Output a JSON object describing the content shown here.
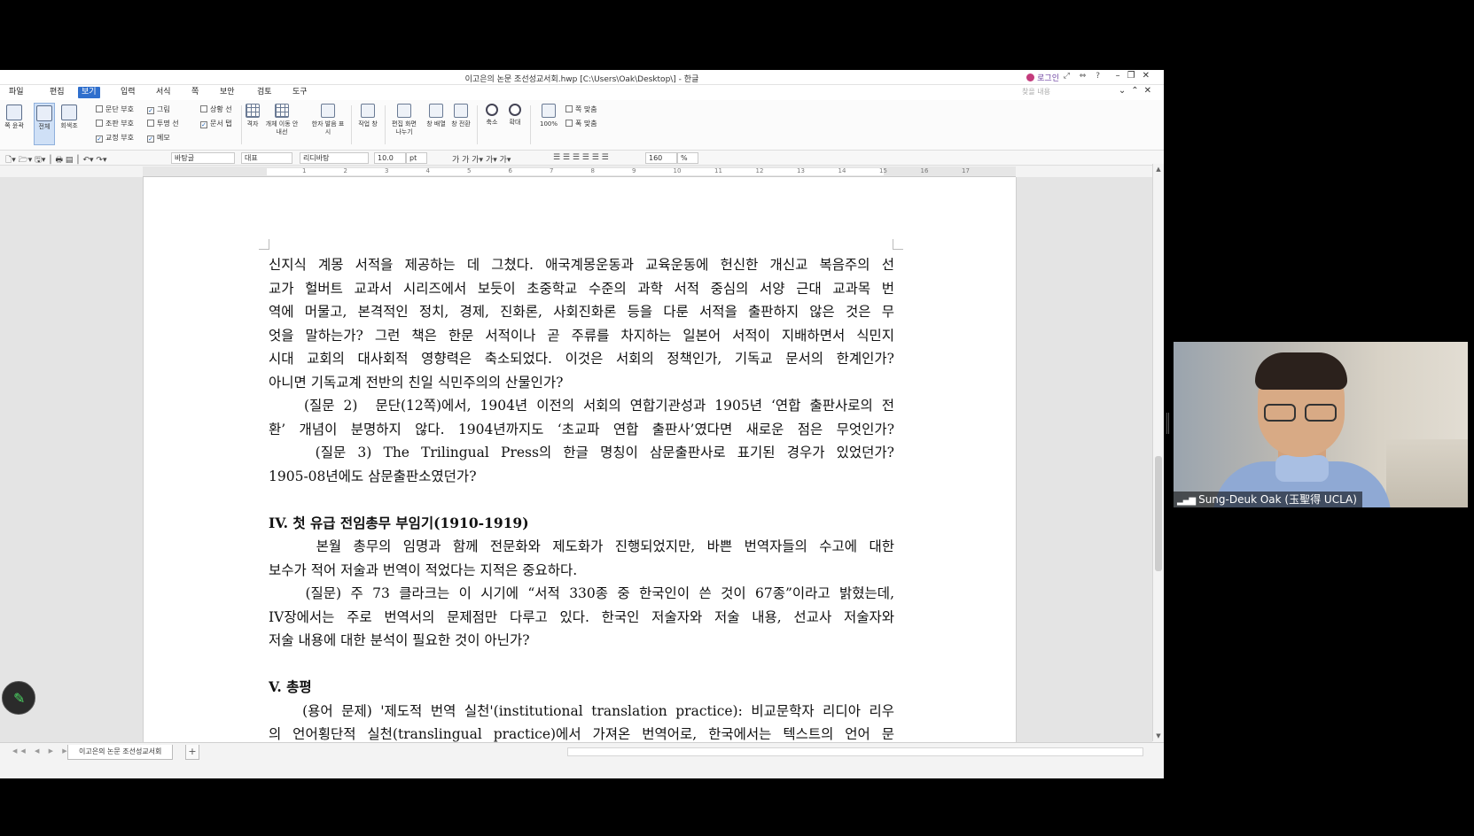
{
  "window": {
    "title": "이고은의 논문 조선성교서회.hwp [C:\\Users\\Oak\\Desktop\\] - 한글",
    "login_label": "로그인"
  },
  "menu": {
    "items": [
      "파일",
      "편집",
      "보기",
      "입력",
      "서식",
      "쪽",
      "보안",
      "검토",
      "도구"
    ],
    "active": "보기",
    "search_placeholder": "찾을 내용"
  },
  "ribbon": {
    "big_buttons": [
      "쪽 윤곽",
      "전체",
      "회색조"
    ],
    "checkboxes_col1": [
      {
        "label": "문단 부호",
        "checked": false
      },
      {
        "label": "조판 부호",
        "checked": false
      },
      {
        "label": "교정 부호",
        "checked": true
      }
    ],
    "checkboxes_col2": [
      {
        "label": "그림",
        "checked": true
      },
      {
        "label": "투명 선",
        "checked": false
      },
      {
        "label": "메모",
        "checked": true
      }
    ],
    "checkboxes_col3": [
      {
        "label": "상황 선",
        "checked": false
      },
      {
        "label": "문서 탭",
        "checked": true
      }
    ],
    "tools": [
      "격자",
      "개체 이동 안내선",
      "한자 발음 표시",
      "작업 창",
      "편집 화면 나누기",
      "창 배열",
      "창 전환",
      "축소",
      "확대",
      "100%"
    ],
    "page_fit": [
      "쪽 맞춤",
      "폭 맞춤"
    ]
  },
  "formatbar": {
    "style": "바탕글",
    "representative": "대표",
    "font": "리디바탕",
    "font_size": "10.0",
    "font_unit": "pt",
    "zoom": "160",
    "zoom_unit": "%"
  },
  "ruler": {
    "ticks": [
      "1",
      "2",
      "3",
      "4",
      "5",
      "6",
      "7",
      "8",
      "9",
      "10",
      "11",
      "12",
      "13",
      "14",
      "15",
      "16",
      "17"
    ]
  },
  "document": {
    "lines": [
      {
        "text": "신지식 계몽 서적을 제공하는 데 그쳤다. 애국계몽운동과 교육운동에 헌신한 개신교 복음주의 선",
        "type": "normal"
      },
      {
        "text": "교가 헐버트 교과서 시리즈에서 보듯이 초중학교 수준의 과학 서적 중심의 서양 근대 교과목 번",
        "type": "normal"
      },
      {
        "text": "역에 머물고, 본격적인 정치, 경제, 진화론, 사회진화론 등을 다룬 서적을 출판하지 않은 것은 무",
        "type": "normal"
      },
      {
        "text": "엇을 말하는가? 그런 책은 한문 서적이나 곧 주류를 차지하는 일본어 서적이 지배하면서 식민지",
        "type": "normal"
      },
      {
        "text": "시대 교회의 대사회적 영향력은 축소되었다. 이것은 서회의 정책인가, 기독교 문서의 한계인가?",
        "type": "normal"
      },
      {
        "text": "아니면 기독교계 전반의 친일 식민주의의 산물인가?",
        "type": "last"
      },
      {
        "text": "    (질문 2)  문단(12쪽)에서, 1904년 이전의 서회의 연합기관성과 1905년 ‘연합 출판사로의 전",
        "type": "normal"
      },
      {
        "text": "환’ 개념이 분명하지 않다. 1904년까지도 ‘초교파 연합 출판사’였다면 새로운 점은 무엇인가?",
        "type": "normal"
      },
      {
        "text": "    (질문 3) The Trilingual Press의 한글 명칭이 삼문출판사로 표기된 경우가 있었던가?",
        "type": "normal"
      },
      {
        "text": "1905-08년에도 삼문출판소였던가?",
        "type": "last"
      },
      {
        "text": "",
        "type": "blank"
      },
      {
        "text": "IV. 첫 유급 전임총무 부임기(1910-1919)",
        "type": "heading"
      },
      {
        "text": "    본월 총무의 임명과 함께 전문화와 제도화가 진행되었지만, 바쁜 번역자들의 수고에 대한",
        "type": "normal"
      },
      {
        "text": "보수가 적어 저술과 번역이 적었다는 지적은 중요하다.",
        "type": "last"
      },
      {
        "text": "    (질문) 주 73 클라크는 이 시기에 “서적 330종 중 한국인이 쓴 것이 67종”이라고 밝혔는데,",
        "type": "normal"
      },
      {
        "text": "IV장에서는 주로 번역서의 문제점만 다루고 있다. 한국인 저술자와 저술 내용, 선교사 저술자와",
        "type": "normal"
      },
      {
        "text": "저술 내용에 대한 분석이 필요한 것이 아닌가?",
        "type": "last"
      },
      {
        "text": "",
        "type": "blank"
      },
      {
        "text": "V. 총평",
        "type": "heading"
      },
      {
        "text": "    (용어 문제) '제도적 번역 실천'(institutional translation practice): 비교문학자 리디아 리우",
        "type": "normal"
      },
      {
        "text": "의 언어횡단적 실천(translingual practice)에서 가져온 번역어로, 한국에서는 텍스트의 언어 문",
        "type": "normal"
      }
    ]
  },
  "statusbar": {
    "doc_tab": "이고은의 논문 조선성교서회",
    "add_tab": "+"
  },
  "video": {
    "participant_name": "Sung-Deuk Oak (玉聖得 UCLA)"
  },
  "colors": {
    "accent": "#2f6fcd",
    "login": "#6b3fa0",
    "fab_icon": "#4cd964"
  }
}
